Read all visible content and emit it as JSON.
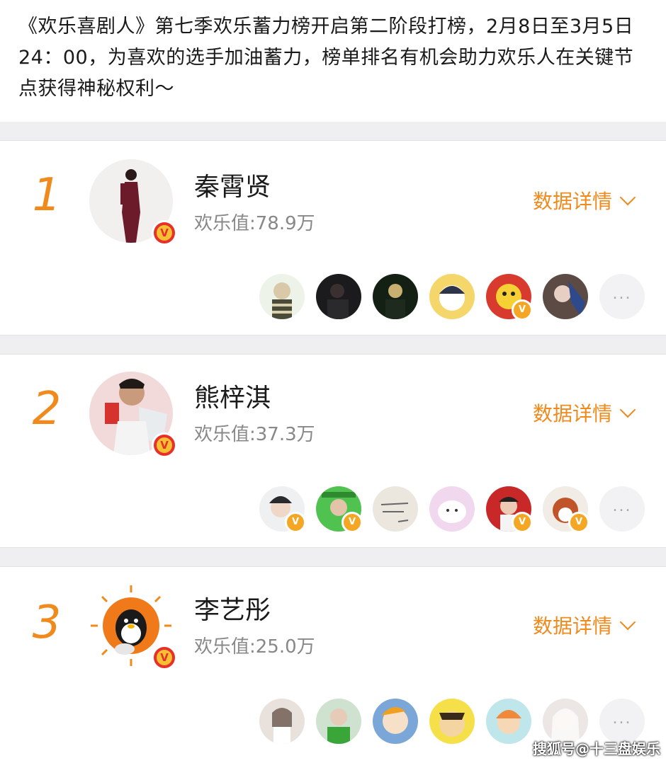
{
  "intro": "《欢乐喜剧人》第七季欢乐蓄力榜开启第二阶段打榜，2月8日至3月5日24：00，为喜欢的选手加油蓄力，榜单排名有机会助力欢乐人在关键节点获得神秘权利～",
  "details_label": "数据详情",
  "more_label": "...",
  "verified_mark": "V",
  "entries": [
    {
      "rank": "1",
      "name": "秦霄贤",
      "score": "欢乐值:78.9万"
    },
    {
      "rank": "2",
      "name": "熊梓淇",
      "score": "欢乐值:37.3万"
    },
    {
      "rank": "3",
      "name": "李艺彤",
      "score": "欢乐值:25.0万"
    }
  ],
  "watermark": "搜狐号@十三盘娱乐",
  "colors": {
    "accent": "#f08a1c",
    "badge_red": "#e8302a",
    "badge_gold": "#f5a623"
  }
}
